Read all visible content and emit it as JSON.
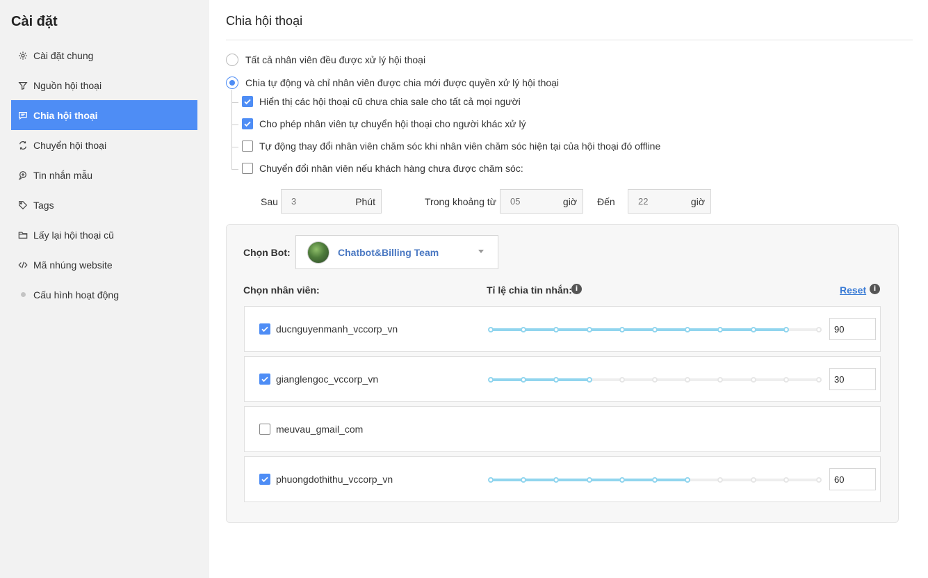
{
  "sidebar": {
    "title": "Cài đặt",
    "items": [
      {
        "label": "Cài đặt chung",
        "icon": "gear-icon"
      },
      {
        "label": "Nguồn hội thoại",
        "icon": "filter-icon"
      },
      {
        "label": "Chia hội thoại",
        "icon": "chat-icon",
        "active": true
      },
      {
        "label": "Chuyển hội thoại",
        "icon": "swap-icon"
      },
      {
        "label": "Tin nhắn mẫu",
        "icon": "template-icon"
      },
      {
        "label": "Tags",
        "icon": "tag-icon"
      },
      {
        "label": "Lấy lại hội thoại cũ",
        "icon": "folder-icon"
      },
      {
        "label": "Mã nhúng website",
        "icon": "code-icon"
      },
      {
        "label": "Cấu hình hoạt động",
        "icon": "dot-icon"
      }
    ]
  },
  "main": {
    "title": "Chia hội thoại",
    "mode_all": {
      "label": "Tất cả nhân viên đều được xử lý hội thoại",
      "selected": false
    },
    "mode_auto": {
      "label": "Chia tự động và chỉ nhân viên được chia mới được quyền xử lý hội thoại",
      "selected": true
    },
    "options": [
      {
        "label": "Hiển thị các hội thoại cũ chưa chia sale cho tất cả mọi người",
        "checked": true
      },
      {
        "label": "Cho phép nhân viên tự chuyển hội thoại cho người khác xử lý",
        "checked": true
      },
      {
        "label": "Tự động thay đổi nhân viên chăm sóc khi nhân viên chăm sóc hiện tại của hội thoại đó offline",
        "checked": false
      },
      {
        "label": "Chuyển đổi nhân viên nếu khách hàng chưa được chăm sóc:",
        "checked": false
      }
    ],
    "after": {
      "label": "Sau",
      "placeholder": "3",
      "unit": "Phút"
    },
    "range_from": {
      "label": "Trong khoảng từ",
      "placeholder": "05",
      "unit": "giờ"
    },
    "range_to": {
      "label": "Đến",
      "placeholder": "22",
      "unit": "giờ"
    }
  },
  "panel": {
    "bot_label": "Chọn Bot:",
    "bot_name": "Chatbot&Billing Team",
    "staff_label": "Chọn nhân viên:",
    "ratio_label": "Tỉ lệ chia tin nhắn:",
    "info_glyph": "i",
    "reset_label": "Reset",
    "staff": [
      {
        "name": "ducnguyenmanh_vccorp_vn",
        "checked": true,
        "ratio": 90,
        "ratio_text": "90"
      },
      {
        "name": "gianglengoc_vccorp_vn",
        "checked": true,
        "ratio": 30,
        "ratio_text": "30"
      },
      {
        "name": "meuvau_gmail_com",
        "checked": false
      },
      {
        "name": "phuongdothithu_vccorp_vn",
        "checked": true,
        "ratio": 60,
        "ratio_text": "60"
      }
    ]
  },
  "colors": {
    "accent": "#4e8df5",
    "slider_fill": "#91d5ee",
    "link": "#3a7bd5"
  }
}
